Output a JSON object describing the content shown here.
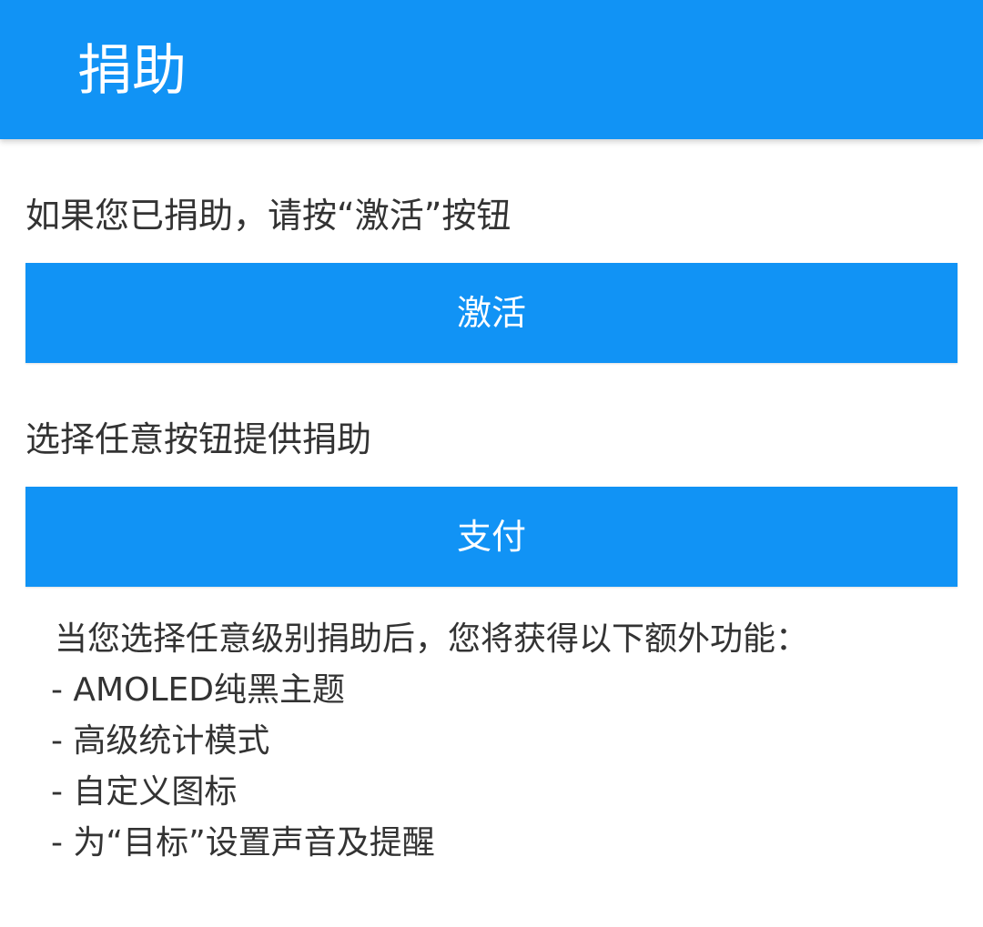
{
  "header": {
    "title": "捐助",
    "background_color": "#1193f5"
  },
  "activate_section": {
    "label": "如果您已捐助，请按“激活”按钮",
    "button_label": "激活"
  },
  "donate_section": {
    "label": "选择任意按钮提供捐助",
    "button_label": "支付"
  },
  "features": {
    "intro": "当您选择任意级别捐助后，您将获得以下额外功能：",
    "items": [
      "- AMOLED纯黑主题",
      "- 高级统计模式",
      "- 自定义图标",
      "- 为“目标”设置声音及提醒"
    ]
  }
}
